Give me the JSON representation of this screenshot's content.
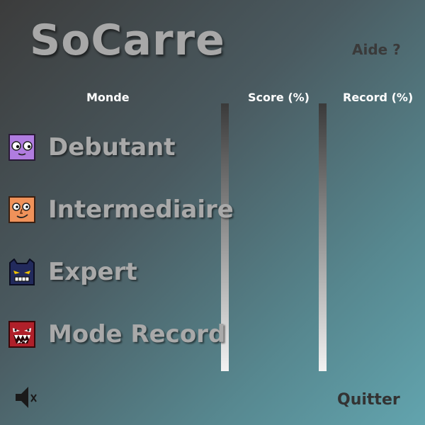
{
  "app": {
    "title": "SoCarre",
    "help_label": "Aide ?"
  },
  "columns": {
    "world": "Monde",
    "score": "Score (%)",
    "record": "Record (%)"
  },
  "worlds": [
    {
      "label": "Debutant",
      "icon": "purple-cube-face-icon",
      "color": "#b07ce0"
    },
    {
      "label": "Intermediaire",
      "icon": "orange-cube-face-icon",
      "color": "#f0925a"
    },
    {
      "label": "Expert",
      "icon": "dark-blue-cube-face-icon",
      "color": "#222a5c"
    },
    {
      "label": "Mode Record",
      "icon": "red-cube-face-icon",
      "color": "#b0202a"
    }
  ],
  "footer": {
    "sound_icon": "speaker-muted-icon",
    "quit_label": "Quitter"
  }
}
